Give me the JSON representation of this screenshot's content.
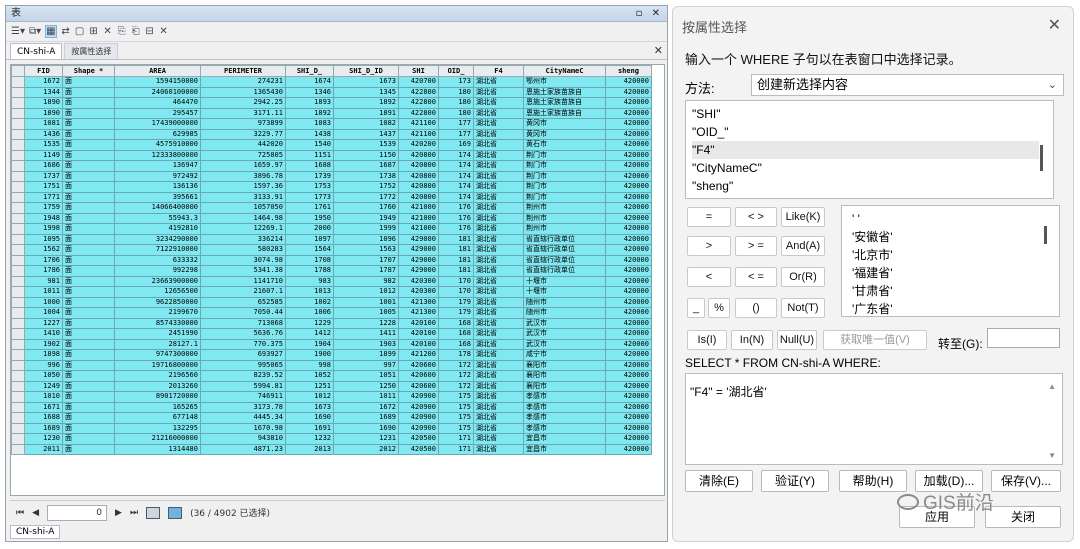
{
  "table_window": {
    "title": "表",
    "controls": "▫ ✕",
    "tabs": [
      "CN-shi-A",
      "按属性选择"
    ],
    "close": "✕",
    "columns": [
      "FID",
      "Shape *",
      "AREA",
      "PERIMETER",
      "SHI_D_",
      "SHI_D_ID",
      "SHI",
      "OID_",
      "F4",
      "CityNameC",
      "sheng"
    ],
    "rows": [
      [
        "1672",
        "面",
        "1594150000",
        "274231",
        "1674",
        "1673",
        "420700",
        "173",
        "湖北省",
        "鄂州市",
        "420000"
      ],
      [
        "1344",
        "面",
        "24060100000",
        "1365430",
        "1346",
        "1345",
        "422800",
        "180",
        "湖北省",
        "恩施土家族苗族自",
        "420000"
      ],
      [
        "1890",
        "面",
        "464470",
        "2942.25",
        "1893",
        "1892",
        "422800",
        "180",
        "湖北省",
        "恩施土家族苗族自",
        "420000"
      ],
      [
        "1890",
        "面",
        "295457",
        "3171.11",
        "1892",
        "1891",
        "422800",
        "180",
        "湖北省",
        "恩施土家族苗族自",
        "420000"
      ],
      [
        "1081",
        "面",
        "17439000000",
        "973899",
        "1083",
        "1082",
        "421100",
        "177",
        "湖北省",
        "黄冈市",
        "420000"
      ],
      [
        "1436",
        "面",
        "629985",
        "3229.77",
        "1438",
        "1437",
        "421100",
        "177",
        "湖北省",
        "黄冈市",
        "420000"
      ],
      [
        "1535",
        "面",
        "4575910000",
        "442020",
        "1540",
        "1539",
        "420200",
        "169",
        "湖北省",
        "黄石市",
        "420000"
      ],
      [
        "1149",
        "面",
        "12333800000",
        "725805",
        "1151",
        "1150",
        "420800",
        "174",
        "湖北省",
        "荆门市",
        "420000"
      ],
      [
        "1686",
        "面",
        "136947",
        "1659.97",
        "1688",
        "1687",
        "420800",
        "174",
        "湖北省",
        "荆门市",
        "420000"
      ],
      [
        "1737",
        "面",
        "972492",
        "3896.78",
        "1739",
        "1738",
        "420800",
        "174",
        "湖北省",
        "荆门市",
        "420000"
      ],
      [
        "1751",
        "面",
        "136136",
        "1597.36",
        "1753",
        "1752",
        "420800",
        "174",
        "湖北省",
        "荆门市",
        "420000"
      ],
      [
        "1771",
        "面",
        "395661",
        "3133.91",
        "1773",
        "1772",
        "420800",
        "174",
        "湖北省",
        "荆门市",
        "420000"
      ],
      [
        "1759",
        "面",
        "14066400000",
        "1057050",
        "1761",
        "1760",
        "421000",
        "176",
        "湖北省",
        "荆州市",
        "420000"
      ],
      [
        "1948",
        "面",
        "55943.3",
        "1464.98",
        "1950",
        "1949",
        "421000",
        "176",
        "湖北省",
        "荆州市",
        "420000"
      ],
      [
        "1998",
        "面",
        "4192810",
        "12269.1",
        "2000",
        "1999",
        "421000",
        "176",
        "湖北省",
        "荆州市",
        "420000"
      ],
      [
        "1095",
        "面",
        "3234290000",
        "336214",
        "1097",
        "1096",
        "429000",
        "181",
        "湖北省",
        "省直辖行政单位",
        "420000"
      ],
      [
        "1562",
        "面",
        "7122910000",
        "580283",
        "1564",
        "1563",
        "429000",
        "181",
        "湖北省",
        "省直辖行政单位",
        "420000"
      ],
      [
        "1706",
        "面",
        "633332",
        "3074.98",
        "1708",
        "1707",
        "429000",
        "181",
        "湖北省",
        "省直辖行政单位",
        "420000"
      ],
      [
        "1786",
        "面",
        "992298",
        "5341.38",
        "1788",
        "1787",
        "429000",
        "181",
        "湖北省",
        "省直辖行政单位",
        "420000"
      ],
      [
        "981",
        "面",
        "23663900000",
        "1141710",
        "983",
        "982",
        "420300",
        "170",
        "湖北省",
        "十堰市",
        "420000"
      ],
      [
        "1011",
        "面",
        "12656500",
        "21607.1",
        "1013",
        "1012",
        "420300",
        "170",
        "湖北省",
        "十堰市",
        "420000"
      ],
      [
        "1000",
        "面",
        "9622850000",
        "652585",
        "1002",
        "1001",
        "421300",
        "179",
        "湖北省",
        "随州市",
        "420000"
      ],
      [
        "1004",
        "面",
        "2199670",
        "7050.44",
        "1006",
        "1005",
        "421300",
        "179",
        "湖北省",
        "随州市",
        "420000"
      ],
      [
        "1227",
        "面",
        "8574330000",
        "713068",
        "1229",
        "1228",
        "420100",
        "168",
        "湖北省",
        "武汉市",
        "420000"
      ],
      [
        "1410",
        "面",
        "2451990",
        "5636.76",
        "1412",
        "1411",
        "420100",
        "168",
        "湖北省",
        "武汉市",
        "420000"
      ],
      [
        "1902",
        "面",
        "28127.1",
        "770.375",
        "1904",
        "1903",
        "420100",
        "168",
        "湖北省",
        "武汉市",
        "420000"
      ],
      [
        "1898",
        "面",
        "9747300000",
        "693927",
        "1900",
        "1899",
        "421200",
        "178",
        "湖北省",
        "咸宁市",
        "420000"
      ],
      [
        "996",
        "面",
        "19716800000",
        "995065",
        "998",
        "997",
        "420600",
        "172",
        "湖北省",
        "襄阳市",
        "420000"
      ],
      [
        "1050",
        "面",
        "2196560",
        "8239.52",
        "1052",
        "1051",
        "420600",
        "172",
        "湖北省",
        "襄阳市",
        "420000"
      ],
      [
        "1249",
        "面",
        "2013260",
        "5994.81",
        "1251",
        "1250",
        "420600",
        "172",
        "湖北省",
        "襄阳市",
        "420000"
      ],
      [
        "1010",
        "面",
        "8901720000",
        "746911",
        "1012",
        "1011",
        "420900",
        "175",
        "湖北省",
        "孝感市",
        "420000"
      ],
      [
        "1671",
        "面",
        "165265",
        "3173.78",
        "1673",
        "1672",
        "420900",
        "175",
        "湖北省",
        "孝感市",
        "420000"
      ],
      [
        "1688",
        "面",
        "677148",
        "4445.34",
        "1690",
        "1689",
        "420900",
        "175",
        "湖北省",
        "孝感市",
        "420000"
      ],
      [
        "1689",
        "面",
        "132295",
        "1670.98",
        "1691",
        "1690",
        "420900",
        "175",
        "湖北省",
        "孝感市",
        "420000"
      ],
      [
        "1230",
        "面",
        "21216000000",
        "943810",
        "1232",
        "1231",
        "420500",
        "171",
        "湖北省",
        "宜昌市",
        "420000"
      ],
      [
        "2011",
        "面",
        "1314480",
        "4871.23",
        "2013",
        "2012",
        "420500",
        "171",
        "湖北省",
        "宜昌市",
        "420000"
      ]
    ],
    "nav": {
      "first": "⏮",
      "prev": "◀",
      "page": "0",
      "next": "▶",
      "last": "⏭",
      "status": "(36 / 4902 已选择)"
    },
    "bottom_tab": "CN-shi-A"
  },
  "dialog": {
    "title": "按属性选择",
    "close": "✕",
    "prompt": "输入一个 WHERE 子句以在表窗口中选择记录。",
    "method_label": "方法:",
    "method_value": "创建新选择内容",
    "fields": [
      "\"SHI\"",
      "\"OID_\"",
      "\"F4\"",
      "\"CityNameC\"",
      "\"sheng\""
    ],
    "operators": [
      "=",
      "< >",
      "Like(K)",
      ">",
      "> =",
      "And(A)",
      "<",
      "< =",
      "Or(R)",
      "_",
      "%",
      "()",
      "Not(T)"
    ],
    "values": [
      "' '",
      "'安徽省'",
      "'北京市'",
      "'福建省'",
      "'甘肃省'",
      "'广东省'"
    ],
    "is_btn": "Is(I)",
    "in_btn": "In(N)",
    "null_btn": "Null(U)",
    "unique_btn": "获取唯一值(V)",
    "goto_label": "转至(G):",
    "sql_header": "SELECT * FROM CN-shi-A WHERE:",
    "expression": "\"F4\" = '湖北省'",
    "clear_btn": "清除(E)",
    "verify_btn": "验证(Y)",
    "help_btn": "帮助(H)",
    "load_btn": "加载(D)...",
    "save_btn": "保存(V)...",
    "apply_btn": "应用",
    "close_btn": "关闭",
    "watermark": "GIS前沿"
  }
}
